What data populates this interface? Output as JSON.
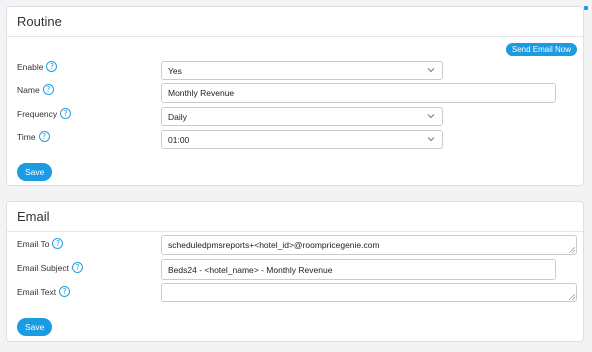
{
  "routine": {
    "title": "Routine",
    "send_email_now_label": "Send Email Now",
    "fields": {
      "enable": {
        "label": "Enable",
        "value": "Yes"
      },
      "name": {
        "label": "Name",
        "value": "Monthly Revenue"
      },
      "frequency": {
        "label": "Frequency",
        "value": "Daily"
      },
      "time": {
        "label": "Time",
        "value": "01:00"
      }
    },
    "save_label": "Save"
  },
  "email": {
    "title": "Email",
    "fields": {
      "to": {
        "label": "Email To",
        "value": "scheduledpmsreports+<hotel_id>@roompricegenie.com"
      },
      "subject": {
        "label": "Email Subject",
        "value": "Beds24 - <hotel_name> - Monthly Revenue"
      },
      "text": {
        "label": "Email Text",
        "value": ""
      }
    },
    "save_label": "Save"
  },
  "icons": {
    "help": "question-circle-icon",
    "dropdown": "chevron-down-icon",
    "resize": "resize-grip-icon"
  },
  "colors": {
    "accent": "#1c9be2",
    "help": "#23a0e0",
    "background": "#f2f3f5",
    "panel": "#ffffff"
  }
}
